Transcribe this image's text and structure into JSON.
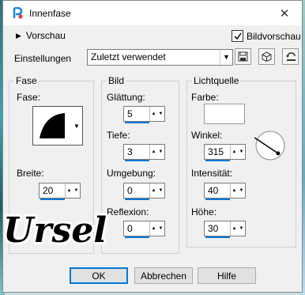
{
  "window": {
    "title": "Innenfase",
    "close_glyph": "✕"
  },
  "header": {
    "preview_label": "Vorschau",
    "image_preview_label": "Bildvorschau",
    "image_preview_checked": true
  },
  "settings": {
    "label": "Einstellungen",
    "selected": "Zuletzt verwendet",
    "icons": [
      "save-icon",
      "cube-icon",
      "reset-icon"
    ]
  },
  "fase_group": {
    "legend": "Fase",
    "fase_label": "Fase:",
    "breite_label": "Breite:",
    "breite_value": "20"
  },
  "bild_group": {
    "legend": "Bild",
    "glaettung_label": "Glättung:",
    "glaettung_value": "5",
    "tiefe_label": "Tiefe:",
    "tiefe_value": "3",
    "umgebung_label": "Umgebung:",
    "umgebung_value": "0",
    "reflexion_label": "Reflexion:",
    "reflexion_value": "0"
  },
  "licht_group": {
    "legend": "Lichtquelle",
    "farbe_label": "Farbe:",
    "farbe_value": "#ffffff",
    "winkel_label": "Winkel:",
    "winkel_value": "315",
    "intensitaet_label": "Intensität:",
    "intensitaet_value": "40",
    "hoehe_label": "Höhe:",
    "hoehe_value": "30"
  },
  "buttons": {
    "ok": "OK",
    "cancel": "Abbrechen",
    "help": "Hilfe"
  },
  "watermark": {
    "text": "Ursel"
  },
  "colors": {
    "accent": "#0078d7",
    "window_bg": "#f0f0f0"
  }
}
